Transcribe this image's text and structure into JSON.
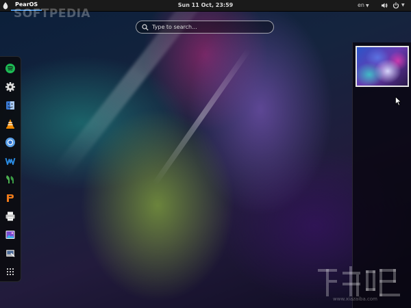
{
  "topbar": {
    "app_name": "PearOS",
    "clock": "Sun 11 Oct, 23:59",
    "language": "en",
    "icons": [
      "pear-icon",
      "volume-icon",
      "power-icon"
    ]
  },
  "watermark": {
    "text": "SOFTPEDIA"
  },
  "search": {
    "placeholder": "Type to search..."
  },
  "dash": {
    "apps": [
      {
        "name": "spotify-icon",
        "color": "#1db954"
      },
      {
        "name": "settings-gear-icon",
        "color": "#e0e0e0"
      },
      {
        "name": "finder-icon",
        "color": "#4a8ad8"
      },
      {
        "name": "vlc-icon",
        "color": "#f08a00"
      },
      {
        "name": "chrome-icon",
        "color": "#3a8ee6"
      },
      {
        "name": "wunderlist-icon",
        "color": "#2a7fd0"
      },
      {
        "name": "pidgin-icon",
        "color": "#4caf50"
      },
      {
        "name": "mail-icon",
        "color": "#f07a1a"
      },
      {
        "name": "printer-icon",
        "color": "#d0d0d0"
      },
      {
        "name": "photo-viewer-icon",
        "color": "#9a5ad8"
      },
      {
        "name": "system-tools-icon",
        "color": "#c8c8c8"
      },
      {
        "name": "show-apps-grid-icon",
        "color": "#cccccc"
      }
    ]
  },
  "site_watermark": {
    "text": "www.xiazaiba.com"
  }
}
